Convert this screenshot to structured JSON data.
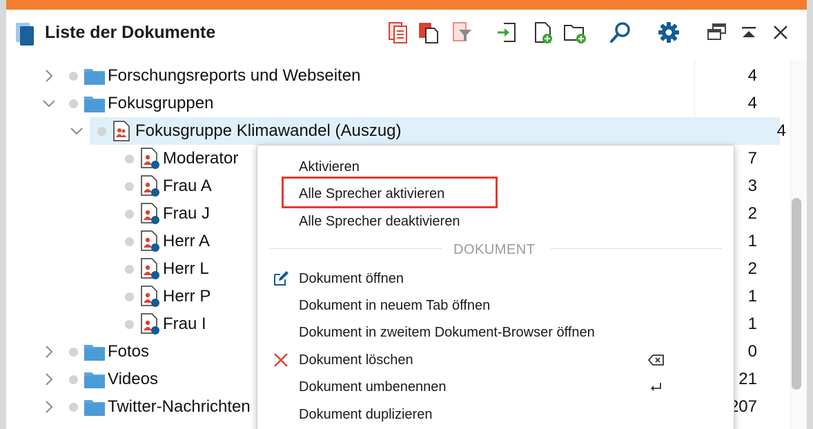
{
  "window": {
    "title": "Liste der Dokumente",
    "accent_color": "#f47d30"
  },
  "toolbar": {
    "icons": [
      "copy-list-icon",
      "duplicate-icon",
      "filter-icon",
      "import-icon",
      "new-document-icon",
      "new-folder-icon",
      "search-icon",
      "settings-icon",
      "undock-icon",
      "collapse-icon",
      "close-icon"
    ]
  },
  "tree": {
    "rows": [
      {
        "label": "Forschungsreports und Webseiten",
        "count": "4"
      },
      {
        "label": "Fokusgruppen",
        "count": "4"
      },
      {
        "label": "Fokusgruppe Klimawandel (Auszug)",
        "count": "4"
      },
      {
        "label": "Moderator",
        "count": "7"
      },
      {
        "label": "Frau A",
        "count": "3"
      },
      {
        "label": "Frau J",
        "count": "2"
      },
      {
        "label": "Herr A",
        "count": "1"
      },
      {
        "label": "Herr L",
        "count": "2"
      },
      {
        "label": "Herr P",
        "count": "1"
      },
      {
        "label": "Frau I",
        "count": "1"
      },
      {
        "label": "Fotos",
        "count": "0"
      },
      {
        "label": "Videos",
        "count": "21"
      },
      {
        "label": "Twitter-Nachrichten",
        "count": "207"
      }
    ]
  },
  "context_menu": {
    "items": [
      {
        "label": "Aktivieren"
      },
      {
        "label": "Alle Sprecher aktivieren"
      },
      {
        "label": "Alle Sprecher deaktivieren"
      },
      {
        "label": "Dokument öffnen"
      },
      {
        "label": "Dokument in neuem Tab öffnen"
      },
      {
        "label": "Dokument in zweitem Dokument-Browser öffnen"
      },
      {
        "label": "Dokument löschen"
      },
      {
        "label": "Dokument umbenennen"
      },
      {
        "label": "Dokument duplizieren"
      }
    ],
    "section_label": "DOKUMENT",
    "highlight_color": "#e63a2e"
  }
}
